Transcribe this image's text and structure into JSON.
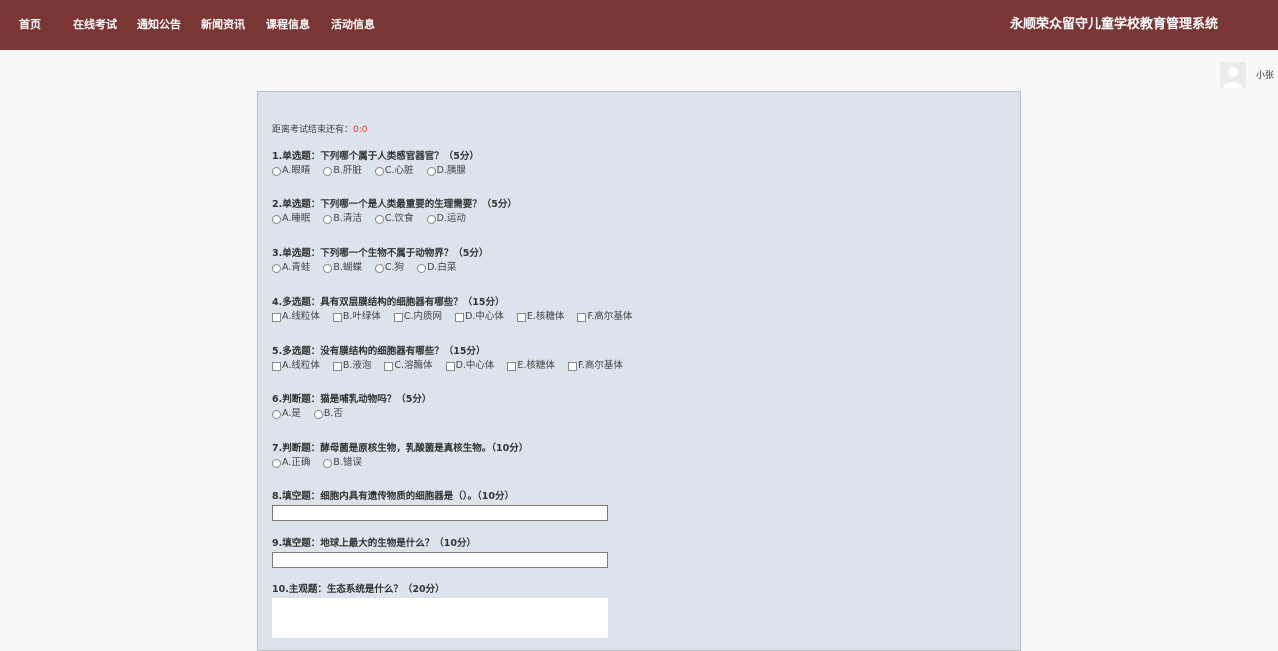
{
  "nav": {
    "items": [
      "首页",
      "在线考试",
      "通知公告",
      "新闻资讯",
      "课程信息",
      "活动信息"
    ],
    "site_title": "永顺荣众留守儿童学校教育管理系统"
  },
  "user": {
    "name": "小张"
  },
  "exam": {
    "timer_label": "距离考试结束还有：",
    "timer_value": "0:0",
    "questions": [
      {
        "title": "1.单选题：下列哪个属于人类感官器官？（5分）",
        "options": [
          "A.眼睛",
          "B.肝脏",
          "C.心脏",
          "D.胰腺"
        ]
      },
      {
        "title": "2.单选题：下列哪一个是人类最重要的生理需要？（5分）",
        "options": [
          "A.睡眠",
          "B.清洁",
          "C.饮食",
          "D.运动"
        ]
      },
      {
        "title": "3.单选题：下列哪一个生物不属于动物界？（5分）",
        "options": [
          "A.青蛙",
          "B.蝴蝶",
          "C.狗",
          "D.白菜"
        ]
      },
      {
        "title": "4.多选题：具有双层膜结构的细胞器有哪些？（15分）",
        "options": [
          "A.线粒体",
          "B.叶绿体",
          "C.内质网",
          "D.中心体",
          "E.核糖体",
          "F.高尔基体"
        ]
      },
      {
        "title": "5.多选题：没有膜结构的细胞器有哪些？（15分）",
        "options": [
          "A.线粒体",
          "B.液泡",
          "C.溶酶体",
          "D.中心体",
          "E.核糖体",
          "F.高尔基体"
        ]
      },
      {
        "title": "6.判断题：猫是哺乳动物吗？（5分）",
        "options": [
          "A.是",
          "B.否"
        ]
      },
      {
        "title": "7.判断题：酵母菌是原核生物，乳酸菌是真核生物。（10分）",
        "options": [
          "A.正确",
          "B.错误"
        ]
      },
      {
        "title": "8.填空题：细胞内具有遗传物质的细胞器是（）。（10分）",
        "answer": ""
      },
      {
        "title": "9.填空题：地球上最大的生物是什么？（10分）",
        "answer": ""
      },
      {
        "title": "10.主观题：生态系统是什么？（20分）",
        "answer": ""
      }
    ]
  },
  "colors": {
    "topbar": "#7a3535",
    "panel": "#dce3ec",
    "timer": "#e53935",
    "page": "#f7f8f9"
  }
}
